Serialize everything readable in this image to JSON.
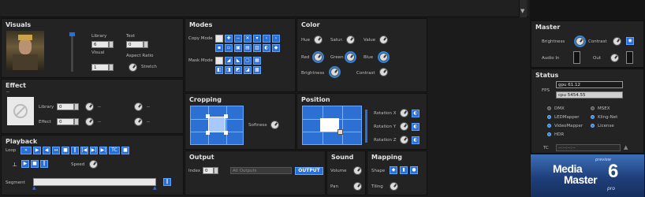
{
  "visuals": {
    "title": "Visuals",
    "library_label": "Library",
    "library_value": "6",
    "visual_label": "Visual",
    "visual_value": "1",
    "text_label": "Text",
    "text_value": "0",
    "aspect_label": "Aspect Ratio",
    "stretch_label": "Stretch"
  },
  "modes": {
    "title": "Modes",
    "copy_mode_label": "Copy Mode",
    "mask_mode_label": "Mask Mode"
  },
  "color": {
    "title": "Color",
    "hue": "Hue",
    "saturation": "Satur.",
    "value": "Value",
    "red": "Red",
    "green": "Green",
    "blue": "Blue",
    "brightness": "Brightness",
    "contrast": "Contrast"
  },
  "effect": {
    "title": "Effect",
    "dash": "--",
    "library_label": "Library",
    "library_value": "0",
    "effect_label": "Effect",
    "effect_value": "0",
    "param_dash": "--"
  },
  "playback": {
    "title": "Playback",
    "loop_label": "Loop",
    "speed_label": "Speed",
    "segment_label": "Segment",
    "tc_button": "TC"
  },
  "cropping": {
    "title": "Cropping",
    "softness_label": "Softness"
  },
  "position": {
    "title": "Position",
    "rot_x": "Rotation X",
    "rot_y": "Rotation Y",
    "rot_z": "Rotation Z"
  },
  "output": {
    "title": "Output",
    "index_label": "Index",
    "index_value": "0",
    "outputs_value": "All Outputs",
    "output_button": "OUTPUT"
  },
  "sound": {
    "title": "Sound",
    "volume_label": "Volume",
    "pan_label": "Pan"
  },
  "mapping": {
    "title": "Mapping",
    "shape_label": "Shape",
    "tiling_label": "Tiling"
  },
  "master": {
    "title": "Master",
    "brightness_label": "Brightness",
    "contrast_label": "Contrast",
    "audio_in_label": "Audio In",
    "out_label": "Out"
  },
  "status": {
    "title": "Status",
    "fps_label": "FPS",
    "gpu_value": "gpu 61.12",
    "cpu_value": "cpu 5454.55",
    "dmx": "DMX",
    "msex": "MSEX",
    "ledmapper": "LEDMapper",
    "klingnet": "Kling-Net",
    "videomapper": "VideoMapper",
    "license": "License",
    "hdr": "HDR",
    "tc_label": "TC",
    "tc_value": "--:--:--:--"
  },
  "logo": {
    "preview": "preview",
    "line1": "Media",
    "line2": "Master",
    "version": "6",
    "pro": "pro"
  },
  "colors": {
    "accent": "#2a6fd6",
    "panel": "#232323",
    "background": "#1b1b1b"
  }
}
